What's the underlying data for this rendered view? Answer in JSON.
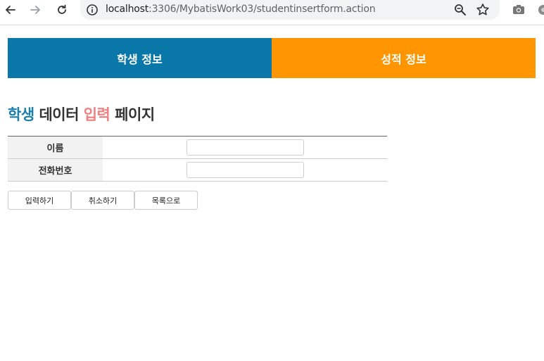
{
  "browser": {
    "url_host": "localhost",
    "url_path": ":3306/MybatisWork03/studentinsertform.action"
  },
  "tabs": [
    {
      "label": "학생 정보",
      "color": "#0a77a9"
    },
    {
      "label": "성적 정보",
      "color": "#ff9500"
    }
  ],
  "heading": {
    "part1": "학생",
    "part2": " 데이터 ",
    "part3": "입력",
    "part4": " 페이지"
  },
  "form": {
    "rows": [
      {
        "label": "이름",
        "value": ""
      },
      {
        "label": "전화번호",
        "value": ""
      }
    ]
  },
  "buttons": {
    "submit": "입력하기",
    "cancel": "취소하기",
    "list": "목록으로"
  },
  "icons": {
    "back": "arrow-left-icon",
    "forward": "arrow-right-icon",
    "reload": "reload-icon",
    "info": "info-icon",
    "zoom": "zoom-icon",
    "star": "star-icon",
    "camera": "camera-icon"
  }
}
